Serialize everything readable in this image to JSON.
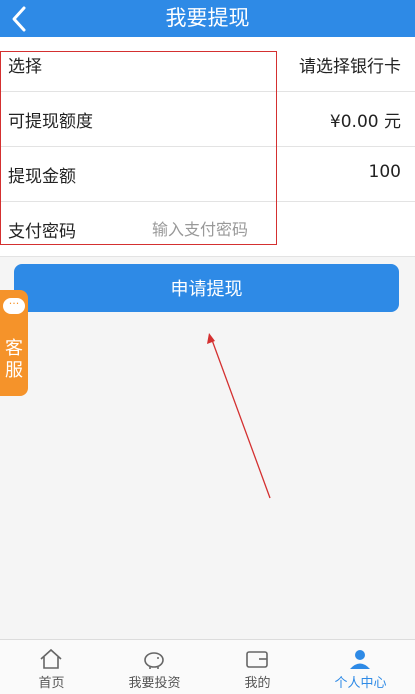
{
  "header": {
    "title": "我要提现",
    "back_icon": "chevron-left-icon"
  },
  "rows": [
    {
      "label": "选择",
      "value": "请选择银行卡"
    },
    {
      "label": "可提现额度",
      "value": "¥0.00 元"
    },
    {
      "label": "提现金额",
      "value": "100"
    },
    {
      "label": "支付密码",
      "placeholder": "输入支付密码"
    }
  ],
  "apply_button": {
    "label": "申请提现"
  },
  "service": {
    "bubble": "···",
    "label": "客服"
  },
  "tabbar": [
    {
      "label": "首页",
      "icon": "home-icon"
    },
    {
      "label": "我要投资",
      "icon": "piggy-bank-icon"
    },
    {
      "label": "我的",
      "icon": "wallet-icon"
    },
    {
      "label": "个人中心",
      "icon": "user-icon",
      "active": true
    }
  ],
  "colors": {
    "primary": "#2e8ae6",
    "service": "#f5932a",
    "annotation": "#d43030"
  }
}
